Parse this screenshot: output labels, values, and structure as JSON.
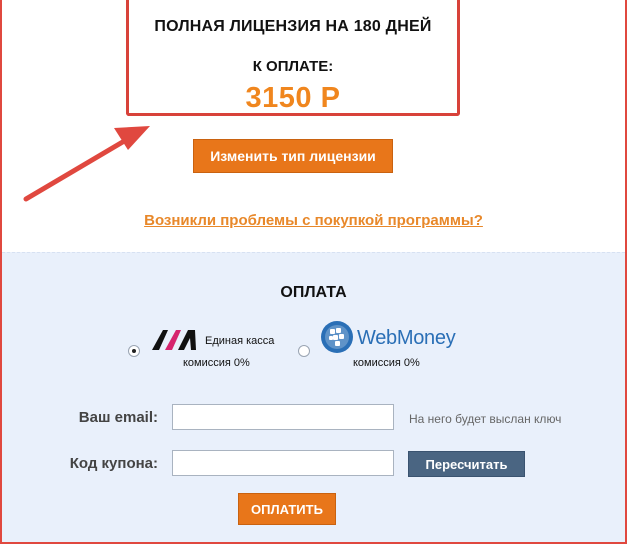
{
  "license": {
    "title": "ПОЛНАЯ ЛИЦЕНЗИЯ НА 180 ДНЕЙ",
    "to_pay_label": "К ОПЛАТЕ:",
    "price": "3150 Р",
    "change_button": "Изменить тип лицензии"
  },
  "problems_link": "Возникли проблемы с покупкой программы?",
  "payment": {
    "title": "ОПЛАТА",
    "methods": [
      {
        "name": "Единая касса",
        "fee": "комиссия 0%",
        "selected": true,
        "icon": "edinaya-kassa-logo"
      },
      {
        "name": "WebMoney",
        "fee": "комиссия 0%",
        "selected": false,
        "icon": "webmoney-globe-logo"
      }
    ]
  },
  "form": {
    "email_label": "Ваш email:",
    "email_value": "",
    "email_hint": "На него будет выслан ключ",
    "coupon_label": "Код купона:",
    "coupon_value": "",
    "recalc_button": "Пересчитать",
    "pay_button": "ОПЛАТИТЬ"
  },
  "colors": {
    "accent_orange": "#e8761a",
    "price_orange": "#f0861e",
    "frame_red": "#d8423a",
    "webmoney_blue": "#2a6fb6",
    "recalc_blue": "#4a6582",
    "payment_bg": "#e9f0fb"
  }
}
